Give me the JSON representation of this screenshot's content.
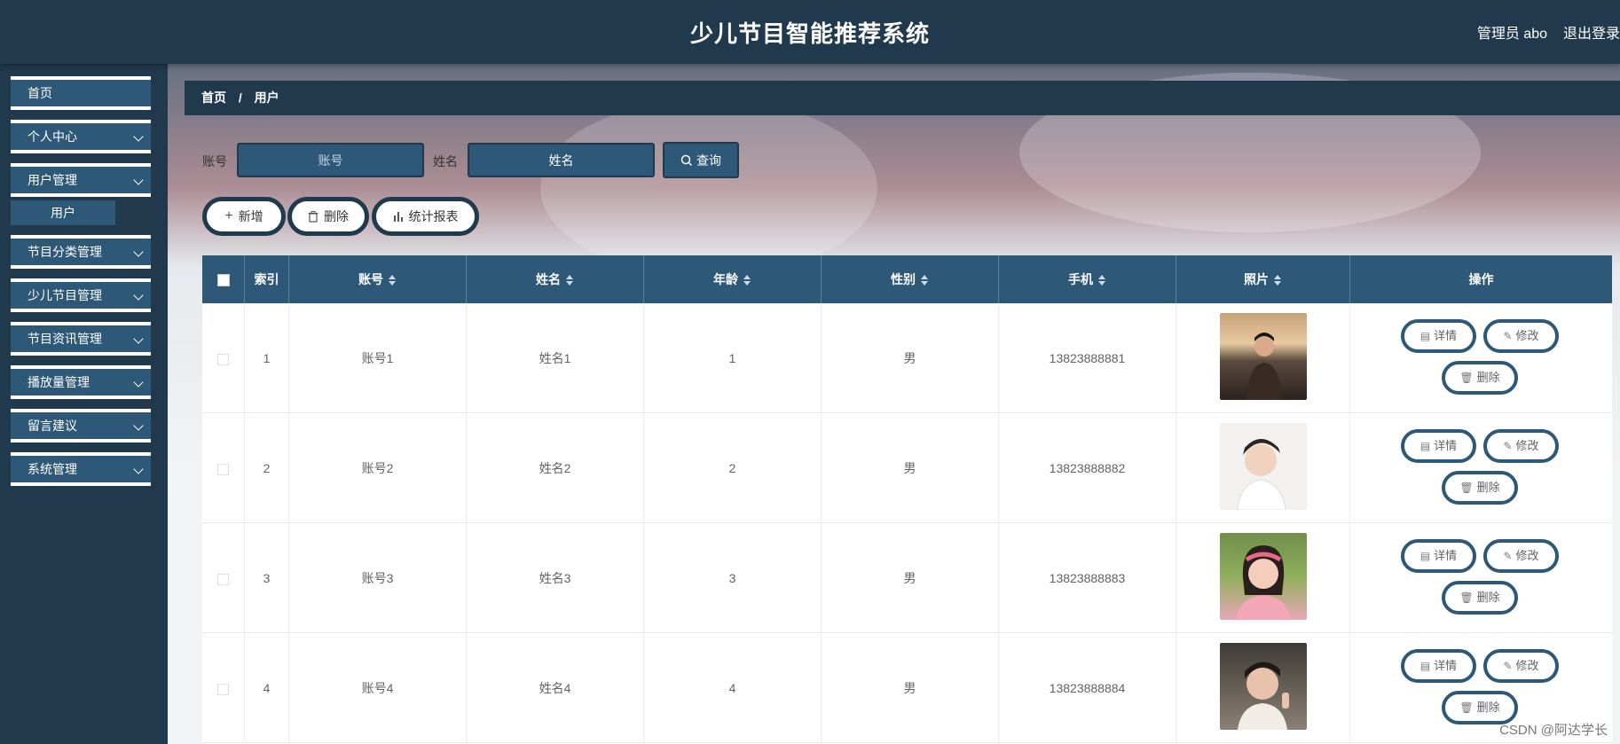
{
  "header": {
    "title": "少儿节目智能推荐系统",
    "user": "管理员 abo",
    "logout": "退出登录"
  },
  "sidebar": {
    "items": [
      {
        "label": "首页"
      },
      {
        "label": "个人中心"
      },
      {
        "label": "用户管理"
      },
      {
        "label": "节目分类管理"
      },
      {
        "label": "少儿节目管理"
      },
      {
        "label": "节目资讯管理"
      },
      {
        "label": "播放量管理"
      },
      {
        "label": "留言建议"
      },
      {
        "label": "系统管理"
      }
    ],
    "sub_item": "用户"
  },
  "breadcrumb": {
    "home": "首页",
    "sep": "/",
    "current": "用户"
  },
  "search": {
    "account_label": "账号",
    "account_placeholder": "账号",
    "name_label": "姓名",
    "name_value": "姓名",
    "query": "查询"
  },
  "actions": {
    "add": "新增",
    "delete": "删除",
    "report": "统计报表"
  },
  "table": {
    "headers": [
      "索引",
      "账号",
      "姓名",
      "年龄",
      "性别",
      "手机",
      "照片",
      "操作"
    ],
    "rows": [
      {
        "index": "1",
        "account": "账号1",
        "name": "姓名1",
        "age": "1",
        "gender": "男",
        "phone": "13823888881"
      },
      {
        "index": "2",
        "account": "账号2",
        "name": "姓名2",
        "age": "2",
        "gender": "男",
        "phone": "13823888882"
      },
      {
        "index": "3",
        "account": "账号3",
        "name": "姓名3",
        "age": "3",
        "gender": "男",
        "phone": "13823888883"
      },
      {
        "index": "4",
        "account": "账号4",
        "name": "姓名4",
        "age": "4",
        "gender": "男",
        "phone": "13823888884"
      }
    ],
    "row_actions": {
      "detail": "详情",
      "edit": "修改",
      "delete": "删除"
    }
  },
  "watermark": "CSDN @阿达学长",
  "colors": {
    "dark": "#21394d",
    "accent": "#2d5878"
  }
}
